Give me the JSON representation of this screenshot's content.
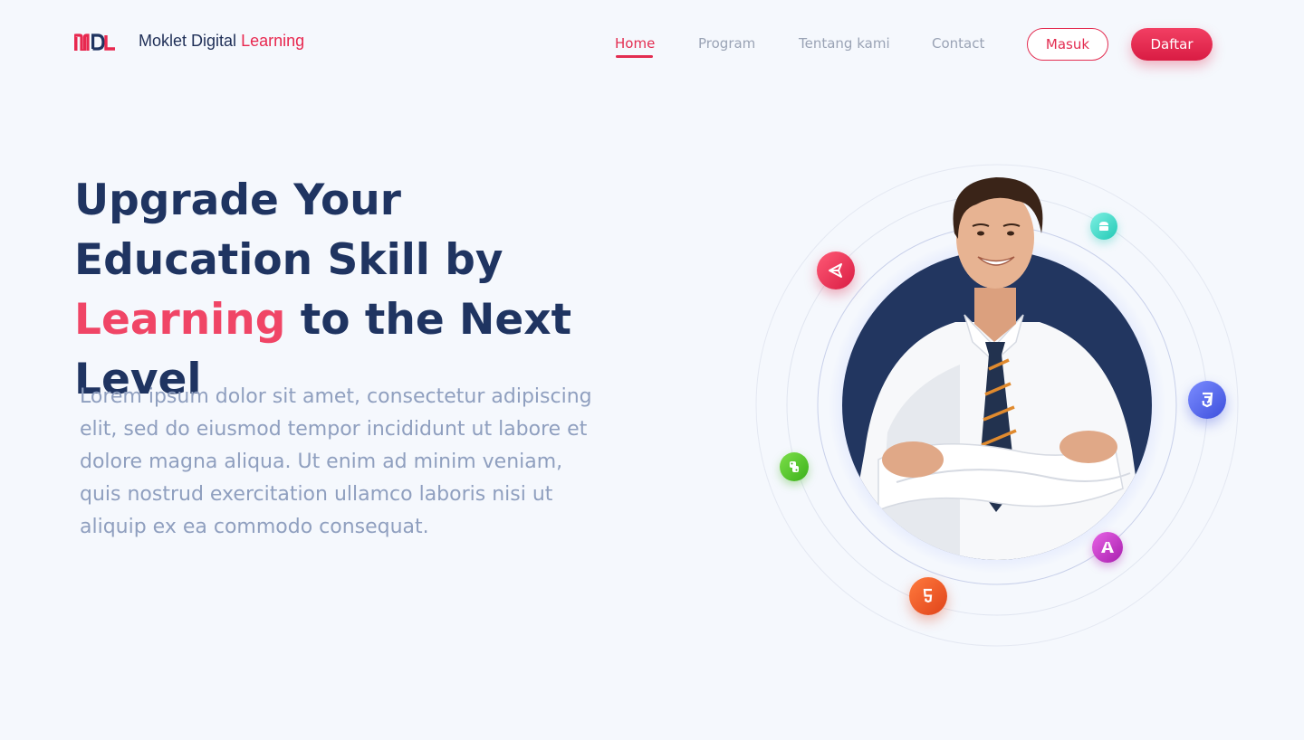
{
  "nav": {
    "brand_name": "Moklet Digital",
    "brand_accent": "Learning",
    "links": [
      {
        "label": "Home",
        "active": true
      },
      {
        "label": "Program",
        "active": false
      },
      {
        "label": "Tentang kami",
        "active": false
      },
      {
        "label": "Contact",
        "active": false
      }
    ],
    "login_label": "Masuk",
    "register_label": "Daftar"
  },
  "hero": {
    "title_part1": "Upgrade Your Education Skill by ",
    "title_highlight": "Learning",
    "title_part2": " to the Next Level",
    "description": "Lorem ipsum dolor sit amet, consectetur adipiscing elit, sed do eiusmod tempor incididunt ut labore et dolore magna aliqua. Ut enim ad minim veniam, quis nostrud exercitation ullamco laboris nisi ut aliquip ex ea commodo consequat."
  },
  "tech_icons": [
    {
      "name": "unity-icon",
      "color": "#e8284f"
    },
    {
      "name": "android-icon",
      "color": "#3fd9c8"
    },
    {
      "name": "css3-icon",
      "color": "#4a5de8"
    },
    {
      "name": "python-icon",
      "color": "#52c41a"
    },
    {
      "name": "adobe-icon",
      "color": "#c837c7"
    },
    {
      "name": "html5-icon",
      "color": "#e8501f"
    }
  ],
  "colors": {
    "primary": "#e32d51",
    "navy": "#1f3461",
    "muted": "#8f9fbf",
    "background": "#f5f8fd"
  }
}
